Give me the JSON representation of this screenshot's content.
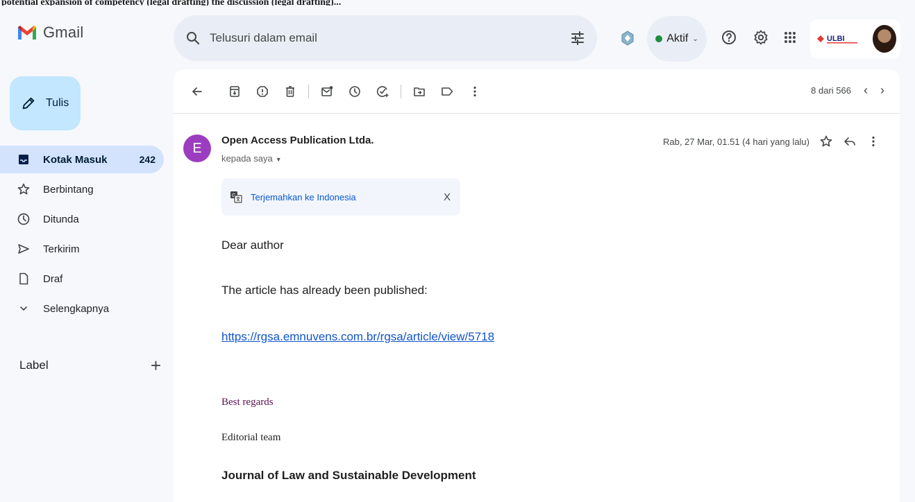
{
  "top_strip": {
    "text": "potential expansion of competency (legal drafting) the discussion (legal drafting)..."
  },
  "app": {
    "name": "Gmail"
  },
  "search": {
    "placeholder": "Telusuri dalam email"
  },
  "status": {
    "label": "Aktif",
    "color": "#1e8e3e"
  },
  "header_icons": [
    "tune-icon",
    "gemini-icon",
    "help-icon",
    "settings-icon",
    "apps-grid-icon"
  ],
  "account": {
    "org": "ULBI"
  },
  "sidebar": {
    "compose_label": "Tulis",
    "items": [
      {
        "label": "Kotak Masuk",
        "count": "242",
        "icon": "inbox-icon",
        "active": true
      },
      {
        "label": "Berbintang",
        "icon": "star-icon"
      },
      {
        "label": "Ditunda",
        "icon": "clock-icon"
      },
      {
        "label": "Terkirim",
        "icon": "send-icon"
      },
      {
        "label": "Draf",
        "icon": "draft-icon"
      },
      {
        "label": "Selengkapnya",
        "icon": "chevron-down-icon"
      }
    ],
    "labels_header": "Label",
    "labels_add": "+"
  },
  "toolbar": {
    "icons": [
      "back-arrow-icon",
      "archive-icon",
      "report-spam-icon",
      "delete-icon",
      "mark-unread-icon",
      "snooze-icon",
      "add-task-icon",
      "move-to-icon",
      "label-icon",
      "more-vert-icon"
    ],
    "pager_text": "8 dari 566",
    "prev": "‹",
    "next": "›"
  },
  "message": {
    "avatar_letter": "E",
    "avatar_color": "#9c3dbf",
    "sender": "Open Access Publication Ltda.",
    "recipient": "kepada saya",
    "date": "Rab, 27 Mar, 01.51 (4 hari yang lalu)",
    "translate_label": "Terjemahkan ke Indonesia",
    "translate_close": "X",
    "greeting": "Dear author",
    "line1": "The article has already been published:",
    "link": "https://rgsa.emnuvens.com.br/rgsa/article/view/5718",
    "regards": "Best regards",
    "team": "Editorial team",
    "journal": "Journal of Law and Sustainable Development"
  }
}
